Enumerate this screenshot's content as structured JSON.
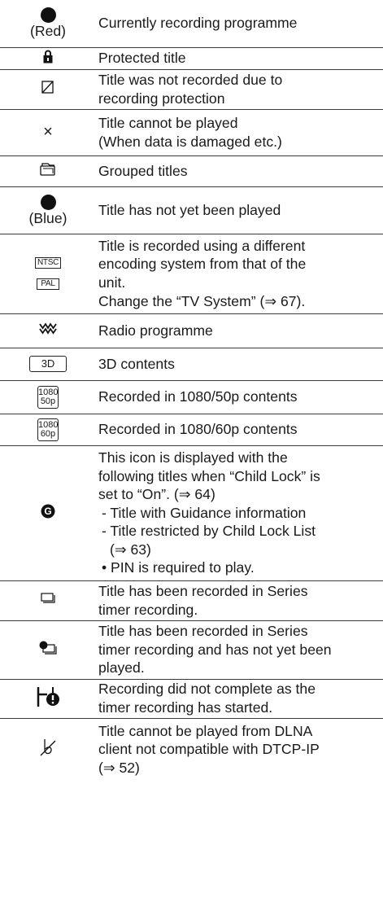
{
  "rows": [
    {
      "icon": "red-dot-icon",
      "icon_caption": "(Red)",
      "lines": [
        "Currently recording programme"
      ]
    },
    {
      "icon": "padlock-icon",
      "lines": [
        "Protected title"
      ]
    },
    {
      "icon": "recording-protection-icon",
      "lines": [
        "Title was not recorded due to",
        "recording protection"
      ]
    },
    {
      "icon": "cross-icon",
      "icon_text": "×",
      "lines": [
        "Title cannot be played",
        "(When data is damaged etc.)"
      ]
    },
    {
      "icon": "grouped-titles-icon",
      "lines": [
        "Grouped titles"
      ]
    },
    {
      "icon": "blue-dot-icon",
      "icon_caption": "(Blue)",
      "lines": [
        "Title has not yet been played"
      ]
    },
    {
      "icon": "ntsc-pal-icon",
      "icon_text_1": "NTSC",
      "icon_text_2": "PAL",
      "lines": [
        "Title is recorded using a different",
        "encoding system from that of the",
        "unit.",
        "Change the “TV System” (⇒ 67)."
      ]
    },
    {
      "icon": "radio-icon",
      "lines": [
        "Radio programme"
      ]
    },
    {
      "icon": "3d-icon",
      "icon_text": "3D",
      "lines": [
        "3D contents"
      ]
    },
    {
      "icon": "1080-50p-icon",
      "icon_text_1": "1080",
      "icon_text_2": "50p",
      "lines": [
        "Recorded in 1080/50p contents"
      ]
    },
    {
      "icon": "1080-60p-icon",
      "icon_text_1": "1080",
      "icon_text_2": "60p",
      "lines": [
        "Recorded in 1080/60p contents"
      ]
    },
    {
      "icon": "guidance-icon",
      "icon_text": "G",
      "intro": [
        "This icon is displayed with the",
        "following titles when “Child Lock” is",
        "set to “On”. (⇒ 64)"
      ],
      "dash1": "- Title with Guidance information",
      "dash2": "- Title restricted by Child Lock List",
      "dash2_cont": "(⇒ 63)",
      "bullet": "• PIN is required to play."
    },
    {
      "icon": "series-timer-icon",
      "lines": [
        "Title has been recorded in Series",
        "timer recording."
      ]
    },
    {
      "icon": "series-timer-unplayed-icon",
      "lines": [
        "Title has been recorded in Series",
        "timer recording and has not yet been",
        "played."
      ]
    },
    {
      "icon": "timer-conflict-icon",
      "lines": [
        "Recording did not complete as the",
        "timer recording has started."
      ]
    },
    {
      "icon": "dlna-restricted-icon",
      "lines": [
        "Title cannot be played from DLNA",
        "client not compatible with DTCP-IP",
        "(⇒ 52)"
      ]
    }
  ]
}
